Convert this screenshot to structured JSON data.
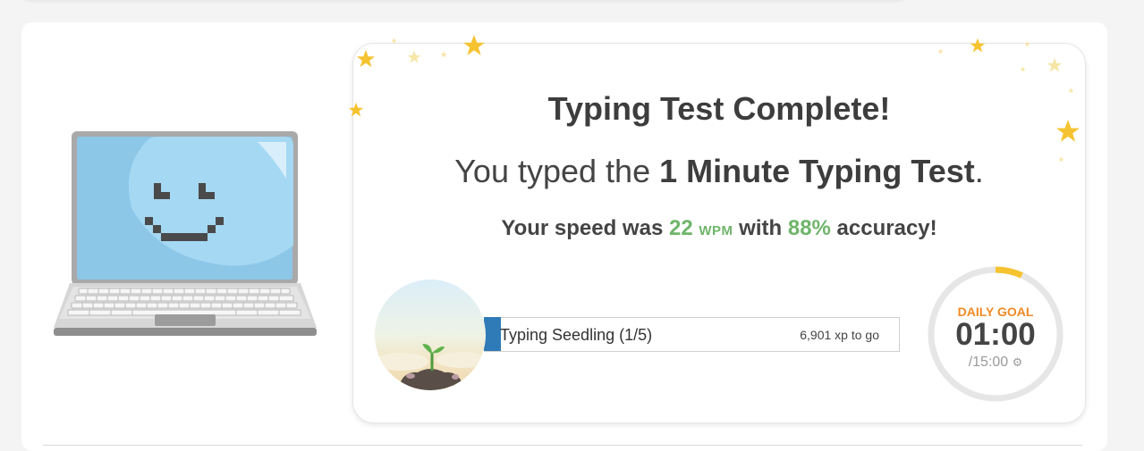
{
  "result": {
    "title": "Typing Test Complete!",
    "subtitle_prefix": "You typed the ",
    "test_name": "1 Minute Typing Test",
    "subtitle_suffix": ".",
    "speed_prefix": "Your speed was ",
    "wpm_value": "22",
    "wpm_unit": "WPM",
    "speed_middle": " with ",
    "accuracy": "88%",
    "speed_suffix": " accuracy!"
  },
  "level": {
    "label": "Typing Seedling (1/5)",
    "xp_remaining": "6,901 xp to go",
    "progress_fraction": 0.04
  },
  "daily_goal": {
    "title": "DAILY GOAL",
    "time": "01:00",
    "total": "/15:00",
    "progress_fraction": 0.067,
    "settings_icon": "gear-icon"
  },
  "colors": {
    "accent_green": "#6fb56a",
    "progress_blue": "#2f7bb8",
    "goal_orange": "#f08a24",
    "goal_ring_yellow": "#f6c330",
    "laptop_screen": "#8cc7e8"
  },
  "icons": {
    "mascot": "smiling-laptop-icon",
    "stars": "star-icon",
    "seedling": "seedling-icon"
  }
}
